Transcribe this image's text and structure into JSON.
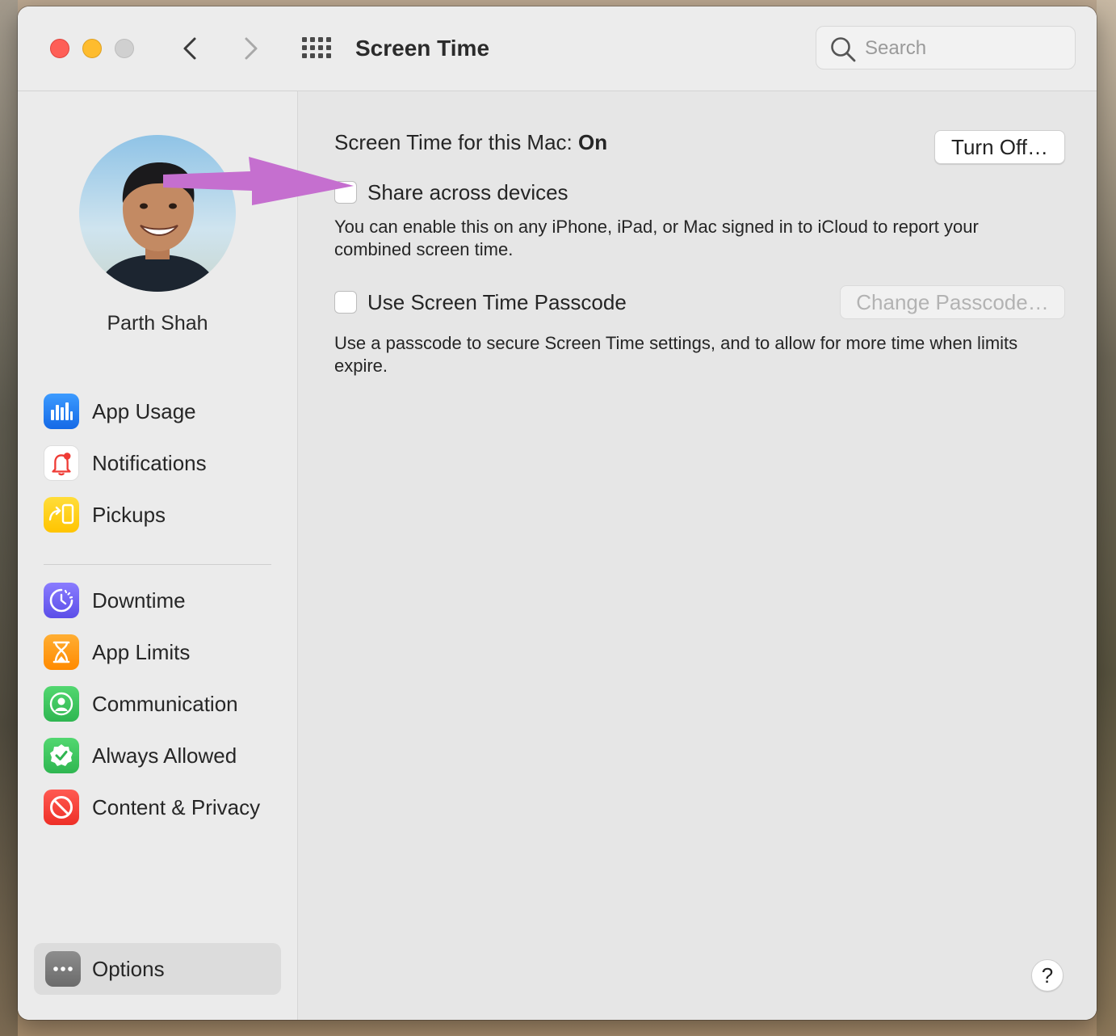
{
  "window": {
    "title": "Screen Time"
  },
  "search": {
    "placeholder": "Search"
  },
  "user": {
    "name": "Parth Shah"
  },
  "sidebar": {
    "items": [
      {
        "label": "App Usage",
        "icon": "app-usage-icon",
        "color": "#1e7cf2"
      },
      {
        "label": "Notifications",
        "icon": "notifications-bell-icon",
        "color": "#ffffff"
      },
      {
        "label": "Pickups",
        "icon": "pickups-icon",
        "color": "#ffcc00"
      },
      {
        "label": "Downtime",
        "icon": "downtime-icon",
        "color": "#6a5cf0"
      },
      {
        "label": "App Limits",
        "icon": "hourglass-icon",
        "color": "#ff9500"
      },
      {
        "label": "Communication",
        "icon": "communication-icon",
        "color": "#34c759"
      },
      {
        "label": "Always Allowed",
        "icon": "always-allowed-icon",
        "color": "#34c759"
      },
      {
        "label": "Content & Privacy",
        "icon": "content-privacy-icon",
        "color": "#ff3b30"
      }
    ],
    "options_label": "Options"
  },
  "main": {
    "status_prefix": "Screen Time for this Mac:",
    "status_value": "On",
    "turn_off_label": "Turn Off…",
    "share_label": "Share across devices",
    "share_desc": "You can enable this on any iPhone, iPad, or Mac signed in to iCloud to report your combined screen time.",
    "passcode_label": "Use Screen Time Passcode",
    "change_passcode_label": "Change Passcode…",
    "passcode_desc": "Use a passcode to secure Screen Time settings, and to allow for more time when limits expire.",
    "help_label": "?"
  },
  "annotation": {
    "arrow_color": "#c56fcf"
  }
}
